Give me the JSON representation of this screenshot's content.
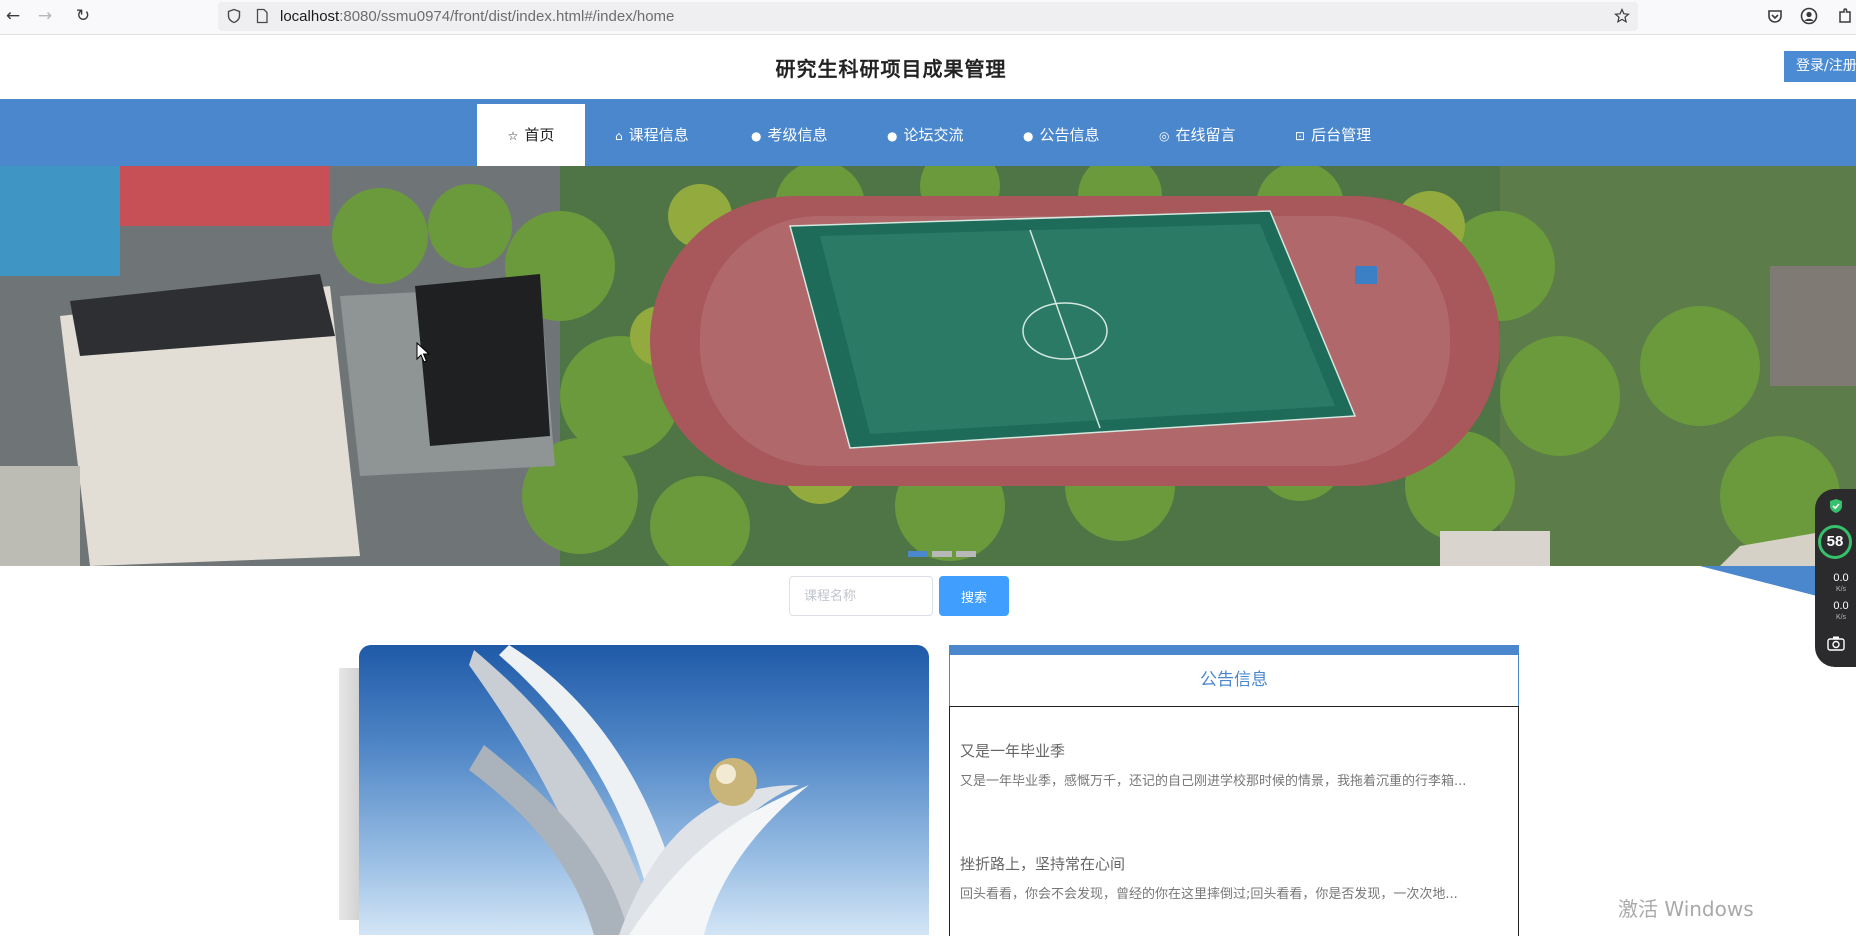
{
  "browser": {
    "url_host": "localhost",
    "url_rest": ":8080/ssmu0974/front/dist/index.html#/index/home",
    "back_icon": "arrow-left-icon",
    "forward_icon": "arrow-right-icon",
    "reload_icon": "reload-icon",
    "bookmark_icon": "star-icon"
  },
  "header": {
    "title": "研究生科研项目成果管理",
    "login_label": "登录/注册"
  },
  "nav": {
    "items": [
      {
        "label": "首页",
        "icon": "star-icon"
      },
      {
        "label": "课程信息",
        "icon": "bag-icon"
      },
      {
        "label": "考级信息",
        "icon": "info-icon"
      },
      {
        "label": "论坛交流",
        "icon": "question-icon"
      },
      {
        "label": "公告信息",
        "icon": "info-icon"
      },
      {
        "label": "在线留言",
        "icon": "chat-icon"
      },
      {
        "label": "后台管理",
        "icon": "briefcase-icon"
      }
    ],
    "active_index": 0
  },
  "search": {
    "placeholder": "课程名称",
    "button_label": "搜索"
  },
  "notice": {
    "heading": "公告信息",
    "items": [
      {
        "title": "又是一年毕业季",
        "excerpt": "又是一年毕业季，感慨万千，还记的自己刚进学校那时候的情景，我拖着沉重的行李箱..."
      },
      {
        "title": "挫折路上，坚持常在心间",
        "excerpt": "回头看看，你会不会发现，曾经的你在这里摔倒过;回头看看，你是否发现，一次次地..."
      }
    ]
  },
  "widget": {
    "gauge_value": "58",
    "gauge_unit": "%",
    "upload": "0.0",
    "download": "0.0",
    "speed_unit": "K/s"
  },
  "watermark": "激活 Windows",
  "colors": {
    "nav_bg": "#4a87cc",
    "login_bg": "#4a8bd4",
    "search_button": "#409eff"
  }
}
